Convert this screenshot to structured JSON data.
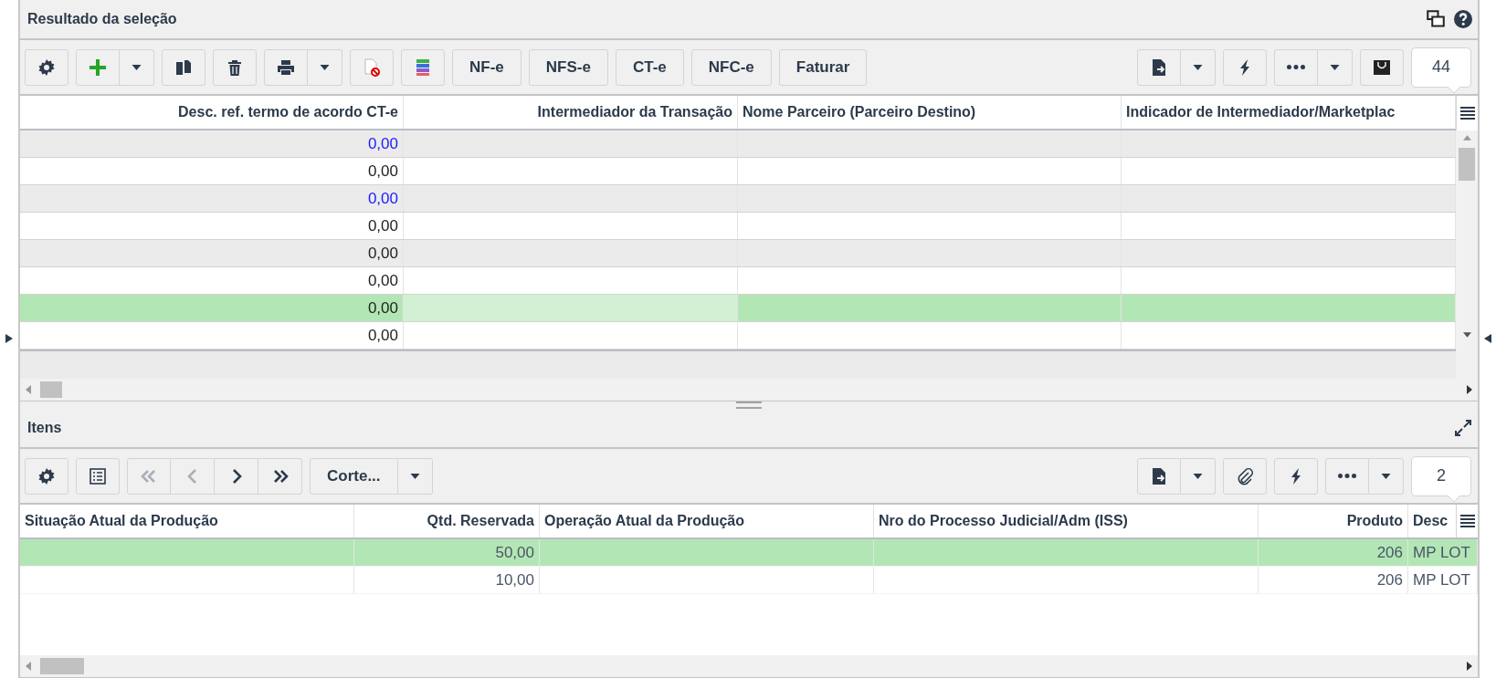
{
  "top_panel": {
    "title": "Resultado da seleção",
    "text_buttons": [
      "NF-e",
      "NFS-e",
      "CT-e",
      "NFC-e",
      "Faturar"
    ],
    "record_count": "44",
    "columns": [
      "Desc. ref. termo de acordo CT-e",
      "Intermediador da Transação",
      "Nome Parceiro (Parceiro Destino)",
      "Indicador de Intermediador/Marketplac"
    ],
    "rows": [
      {
        "value": "0,00",
        "color": "#1a1aff",
        "selected": false,
        "cell_cursor": false
      },
      {
        "value": "0,00",
        "color": "#222222",
        "selected": false,
        "cell_cursor": false
      },
      {
        "value": "0,00",
        "color": "#1a1aff",
        "selected": false,
        "cell_cursor": false
      },
      {
        "value": "0,00",
        "color": "#222222",
        "selected": false,
        "cell_cursor": false
      },
      {
        "value": "0,00",
        "color": "#222222",
        "selected": false,
        "cell_cursor": false
      },
      {
        "value": "0,00",
        "color": "#222222",
        "selected": false,
        "cell_cursor": false
      },
      {
        "value": "0,00",
        "color": "#222222",
        "selected": true,
        "cell_cursor": true
      },
      {
        "value": "0,00",
        "color": "#222222",
        "selected": false,
        "cell_cursor": false
      }
    ]
  },
  "bottom_panel": {
    "title": "Itens",
    "pager": [
      {
        "kind": "first",
        "disabled": true
      },
      {
        "kind": "prev",
        "disabled": true
      },
      {
        "kind": "next",
        "disabled": false
      },
      {
        "kind": "last",
        "disabled": false
      }
    ],
    "cut_button": "Corte...",
    "record_count": "2",
    "columns": [
      "Situação Atual da Produção",
      "Qtd. Reservada",
      "Operação Atual da Produção",
      "Nro do Processo Judicial/Adm (ISS)",
      "Produto",
      "Desc"
    ],
    "rows": [
      {
        "selected": true,
        "qtd": "50,00",
        "produto": "206",
        "column_6": "MP LOT"
      },
      {
        "selected": false,
        "qtd": "10,00",
        "produto": "206",
        "column_6": "MP LOT"
      }
    ]
  }
}
